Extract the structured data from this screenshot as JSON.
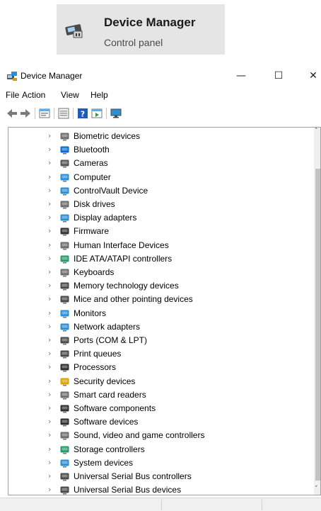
{
  "search_result": {
    "title": "Device Manager",
    "subtitle": "Control panel",
    "icon": "device-manager-icon"
  },
  "window": {
    "title": "Device Manager",
    "controls": {
      "minimize": "—",
      "maximize": "☐",
      "close": "✕"
    }
  },
  "menu": {
    "items": [
      {
        "label": "File"
      },
      {
        "label": "Action"
      },
      {
        "label": "View"
      },
      {
        "label": "Help"
      }
    ]
  },
  "toolbar": {
    "buttons": [
      "back-icon",
      "forward-icon",
      "properties-icon",
      "show-hidden-icon",
      "help-icon",
      "run-icon",
      "scan-hardware-icon"
    ]
  },
  "tree": {
    "expander": "›",
    "items": [
      {
        "label": "Biometric devices",
        "icon": "fingerprint-icon",
        "color": "#6d6d6d"
      },
      {
        "label": "Bluetooth",
        "icon": "bluetooth-icon",
        "color": "#0a6cd6"
      },
      {
        "label": "Cameras",
        "icon": "camera-icon",
        "color": "#555555"
      },
      {
        "label": "Computer",
        "icon": "computer-icon",
        "color": "#2b8fd6"
      },
      {
        "label": "ControlVault Device",
        "icon": "controlvault-icon",
        "color": "#2b8fd6"
      },
      {
        "label": "Disk drives",
        "icon": "disk-drive-icon",
        "color": "#6d6d6d"
      },
      {
        "label": "Display adapters",
        "icon": "display-adapter-icon",
        "color": "#2b8fd6"
      },
      {
        "label": "Firmware",
        "icon": "firmware-icon",
        "color": "#333333"
      },
      {
        "label": "Human Interface Devices",
        "icon": "hid-icon",
        "color": "#6d6d6d"
      },
      {
        "label": "IDE ATA/ATAPI controllers",
        "icon": "ide-controller-icon",
        "color": "#2a9a6a"
      },
      {
        "label": "Keyboards",
        "icon": "keyboard-icon",
        "color": "#6d6d6d"
      },
      {
        "label": "Memory technology devices",
        "icon": "memory-icon",
        "color": "#4a4a4a"
      },
      {
        "label": "Mice and other pointing devices",
        "icon": "mouse-icon",
        "color": "#4a4a4a"
      },
      {
        "label": "Monitors",
        "icon": "monitor-icon",
        "color": "#2b8fd6"
      },
      {
        "label": "Network adapters",
        "icon": "network-adapter-icon",
        "color": "#2b8fd6"
      },
      {
        "label": "Ports (COM & LPT)",
        "icon": "port-icon",
        "color": "#4a4a4a"
      },
      {
        "label": "Print queues",
        "icon": "printer-icon",
        "color": "#4a4a4a"
      },
      {
        "label": "Processors",
        "icon": "processor-icon",
        "color": "#2f2f2f"
      },
      {
        "label": "Security devices",
        "icon": "security-device-icon",
        "color": "#d9a400"
      },
      {
        "label": "Smart card readers",
        "icon": "smart-card-icon",
        "color": "#6d6d6d"
      },
      {
        "label": "Software components",
        "icon": "software-component-icon",
        "color": "#2f2f2f"
      },
      {
        "label": "Software devices",
        "icon": "software-device-icon",
        "color": "#2f2f2f"
      },
      {
        "label": "Sound, video and game controllers",
        "icon": "speaker-icon",
        "color": "#6d6d6d"
      },
      {
        "label": "Storage controllers",
        "icon": "storage-controller-icon",
        "color": "#2a9a6a"
      },
      {
        "label": "System devices",
        "icon": "system-device-icon",
        "color": "#2b8fd6"
      },
      {
        "label": "Universal Serial Bus controllers",
        "icon": "usb-icon",
        "color": "#4a4a4a"
      },
      {
        "label": "Universal Serial Bus devices",
        "icon": "usb-icon",
        "color": "#4a4a4a"
      }
    ]
  },
  "scrollbar": {
    "up": "˄",
    "down": "˅"
  }
}
